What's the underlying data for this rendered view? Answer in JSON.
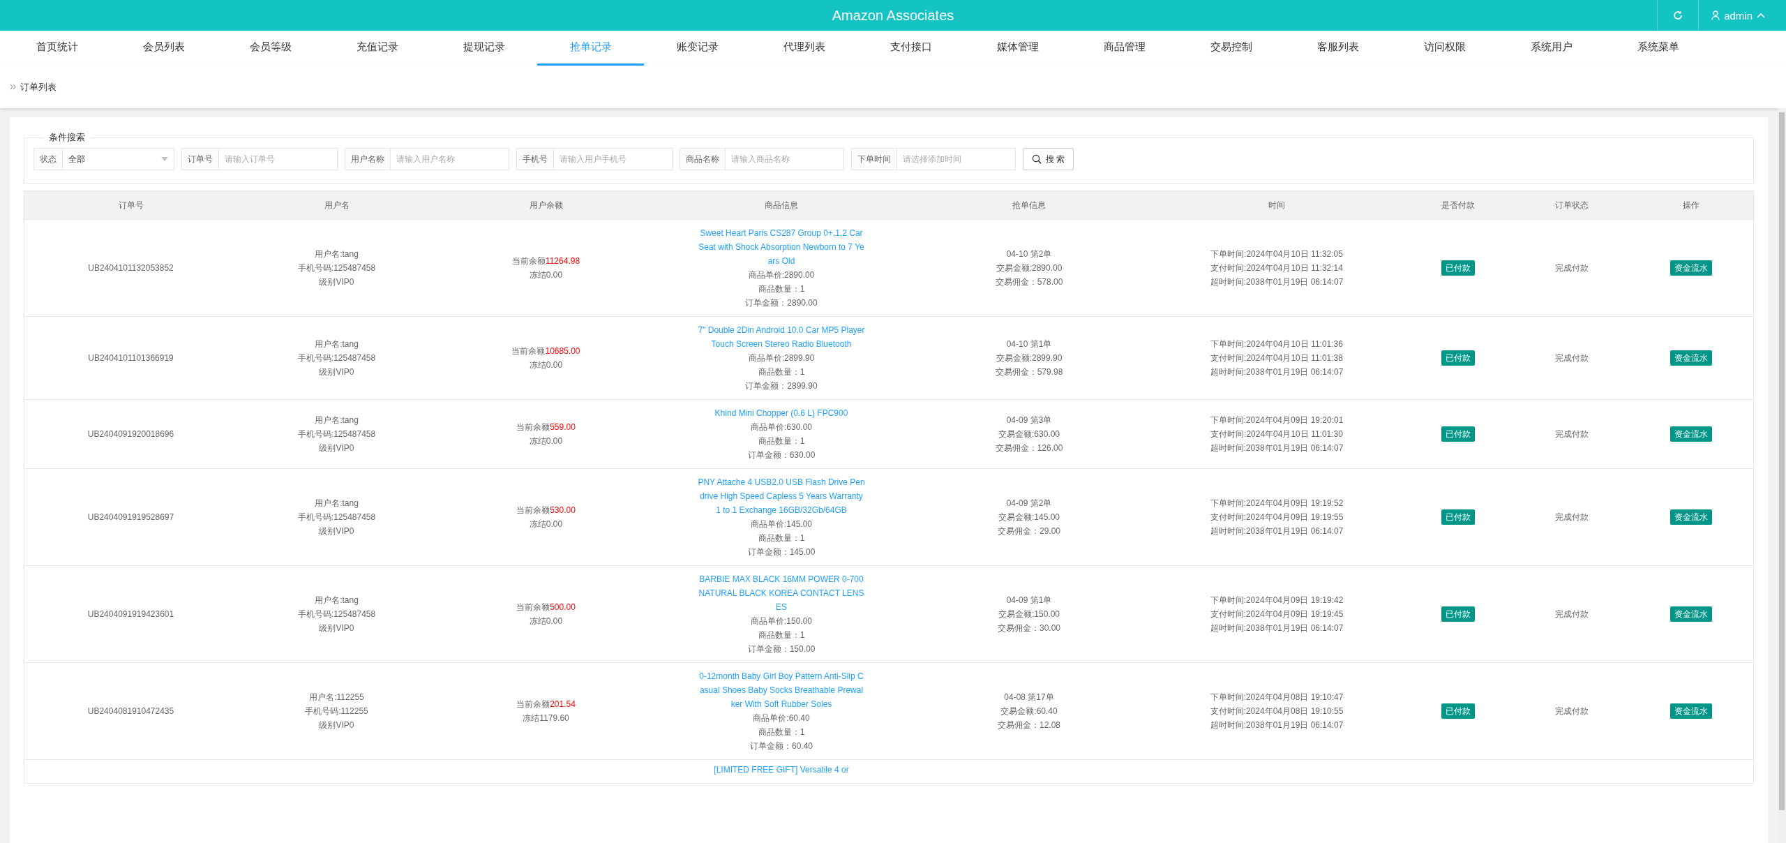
{
  "header": {
    "title": "Amazon Associates",
    "user": "admin"
  },
  "nav": [
    {
      "label": "首页统计",
      "selected": false
    },
    {
      "label": "会员列表",
      "selected": false
    },
    {
      "label": "会员等级",
      "selected": false
    },
    {
      "label": "充值记录",
      "selected": false
    },
    {
      "label": "提现记录",
      "selected": false
    },
    {
      "label": "抢单记录",
      "selected": true
    },
    {
      "label": "账变记录",
      "selected": false
    },
    {
      "label": "代理列表",
      "selected": false
    },
    {
      "label": "支付接口",
      "selected": false
    },
    {
      "label": "媒体管理",
      "selected": false
    },
    {
      "label": "商品管理",
      "selected": false
    },
    {
      "label": "交易控制",
      "selected": false
    },
    {
      "label": "客服列表",
      "selected": false
    },
    {
      "label": "访问权限",
      "selected": false
    },
    {
      "label": "系统用户",
      "selected": false
    },
    {
      "label": "系统菜单",
      "selected": false
    }
  ],
  "breadcrumb": "订单列表",
  "search": {
    "legend": "条件搜索",
    "status": {
      "label": "状态",
      "value": "全部"
    },
    "fields": [
      {
        "label": "订单号",
        "placeholder": "请输入订单号"
      },
      {
        "label": "用户名称",
        "placeholder": "请输入用户名称"
      },
      {
        "label": "手机号",
        "placeholder": "请输入用户手机号"
      },
      {
        "label": "商品名称",
        "placeholder": "请输入商品名称"
      },
      {
        "label": "下单时间",
        "placeholder": "请选择添加时间"
      }
    ],
    "button": "搜 索"
  },
  "table": {
    "columns": [
      "订单号",
      "用户名",
      "用户余额",
      "商品信息",
      "抢单信息",
      "时间",
      "是否付款",
      "订单状态",
      "操作"
    ],
    "rows": [
      {
        "order_no": "UB2404101132053852",
        "user": [
          "用户名:tang",
          "手机号码:125487458",
          "级别VIP0"
        ],
        "balance_label": "当前余额",
        "balance": "11264.98",
        "frozen": "冻结0.00",
        "product": {
          "name": "Sweet Heart Paris CS287 Group 0+,1,2 Car Seat with Shock Absorption Newborn to 7 Years Old",
          "details": [
            "商品单价:2890.00",
            "商品数量：1",
            "订单金额：2890.00"
          ]
        },
        "grab": [
          "04-10 第2单",
          "交易金额:2890.00",
          "交易佣金：578.00"
        ],
        "times": [
          "下单时间:2024年04月10日 11:32:05",
          "支付时间:2024年04月10日 11:32:14",
          "超时时间:2038年01月19日 06:14:07"
        ],
        "paid": "已付款",
        "status": "完成付款",
        "action": "资金流水"
      },
      {
        "order_no": "UB2404101101366919",
        "user": [
          "用户名:tang",
          "手机号码:125487458",
          "级别VIP0"
        ],
        "balance_label": "当前余额",
        "balance": "10685.00",
        "frozen": "冻结0.00",
        "product": {
          "name": "7\" Double 2Din Android 10.0 Car MP5 Player Touch Screen Stereo Radio Bluetooth",
          "details": [
            "商品单价:2899.90",
            "商品数量：1",
            "订单金额：2899.90"
          ]
        },
        "grab": [
          "04-10 第1单",
          "交易金额:2899.90",
          "交易佣金：579.98"
        ],
        "times": [
          "下单时间:2024年04月10日 11:01:36",
          "支付时间:2024年04月10日 11:01:38",
          "超时时间:2038年01月19日 06:14:07"
        ],
        "paid": "已付款",
        "status": "完成付款",
        "action": "资金流水"
      },
      {
        "order_no": "UB2404091920018696",
        "user": [
          "用户名:tang",
          "手机号码:125487458",
          "级别VIP0"
        ],
        "balance_label": "当前余额",
        "balance": "559.00",
        "frozen": "冻结0.00",
        "product": {
          "name": "Khind Mini Chopper (0.6 L) FPC900",
          "details": [
            "商品单价:630.00",
            "商品数量：1",
            "订单金额：630.00"
          ]
        },
        "grab": [
          "04-09 第3单",
          "交易金额:630.00",
          "交易佣金：126.00"
        ],
        "times": [
          "下单时间:2024年04月09日 19:20:01",
          "支付时间:2024年04月10日 11:01:30",
          "超时时间:2038年01月19日 06:14:07"
        ],
        "paid": "已付款",
        "status": "完成付款",
        "action": "资金流水"
      },
      {
        "order_no": "UB2404091919528697",
        "user": [
          "用户名:tang",
          "手机号码:125487458",
          "级别VIP0"
        ],
        "balance_label": "当前余额",
        "balance": "530.00",
        "frozen": "冻结0.00",
        "product": {
          "name": "PNY Attache 4 USB2.0 USB Flash Drive Pendrive High Speed Capless 5 Years Warranty 1 to 1 Exchange 16GB/32Gb/64GB",
          "details": [
            "商品单价:145.00",
            "商品数量：1",
            "订单金额：145.00"
          ]
        },
        "grab": [
          "04-09 第2单",
          "交易金额:145.00",
          "交易佣金：29.00"
        ],
        "times": [
          "下单时间:2024年04月09日 19:19:52",
          "支付时间:2024年04月09日 19:19:55",
          "超时时间:2038年01月19日 06:14:07"
        ],
        "paid": "已付款",
        "status": "完成付款",
        "action": "资金流水"
      },
      {
        "order_no": "UB2404091919423601",
        "user": [
          "用户名:tang",
          "手机号码:125487458",
          "级别VIP0"
        ],
        "balance_label": "当前余额",
        "balance": "500.00",
        "frozen": "冻结0.00",
        "product": {
          "name": "BARBIE MAX BLACK 16MM POWER 0-700 NATURAL BLACK KOREA CONTACT LENSES",
          "details": [
            "商品单价:150.00",
            "商品数量：1",
            "订单金额：150.00"
          ]
        },
        "grab": [
          "04-09 第1单",
          "交易金额:150.00",
          "交易佣金：30.00"
        ],
        "times": [
          "下单时间:2024年04月09日 19:19:42",
          "支付时间:2024年04月09日 19:19:45",
          "超时时间:2038年01月19日 06:14:07"
        ],
        "paid": "已付款",
        "status": "完成付款",
        "action": "资金流水"
      },
      {
        "order_no": "UB2404081910472435",
        "user": [
          "用户名:112255",
          "手机号码:112255",
          "级别VIP0"
        ],
        "balance_label": "当前余额",
        "balance": "201.54",
        "frozen": "冻结1179.60",
        "product": {
          "name": "0-12month Baby Girl Boy Pattern Anti-Slip Casual Shoes Baby Socks Breathable Prewalker With Soft Rubber Soles",
          "details": [
            "商品单价:60.40",
            "商品数量：1",
            "订单金额：60.40"
          ]
        },
        "grab": [
          "04-08 第17单",
          "交易金额:60.40",
          "交易佣金：12.08"
        ],
        "times": [
          "下单时间:2024年04月08日 19:10:47",
          "支付时间:2024年04月08日 19:10:55",
          "超时时间:2038年01月19日 06:14:07"
        ],
        "paid": "已付款",
        "status": "完成付款",
        "action": "资金流水"
      }
    ],
    "partial_row": {
      "product_name": "[LIMITED FREE GIFT] Versatile 4 or"
    }
  }
}
